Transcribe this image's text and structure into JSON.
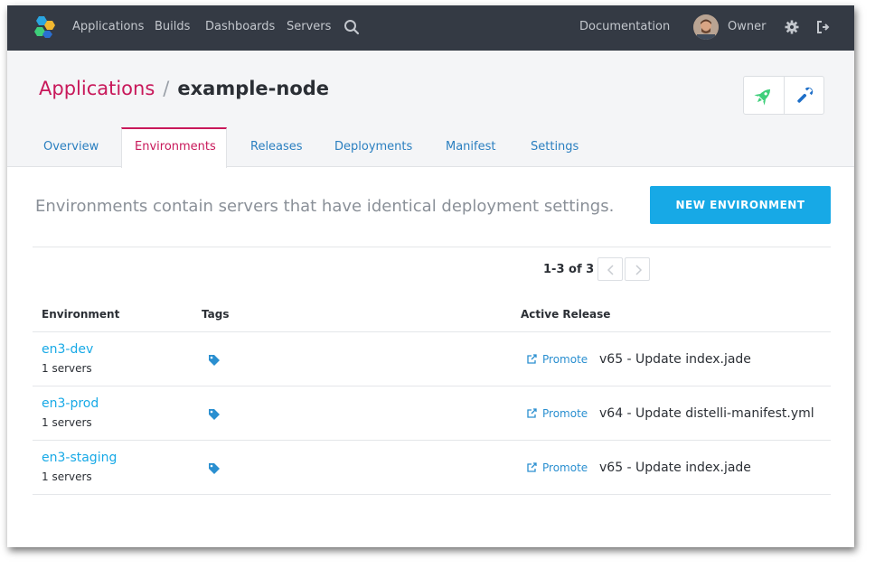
{
  "nav": {
    "items": [
      "Applications",
      "Builds",
      "Dashboards",
      "Servers"
    ],
    "documentation": "Documentation",
    "user": "Owner"
  },
  "breadcrumb": {
    "parent": "Applications",
    "separator": "/",
    "current": "example-node"
  },
  "tabs": [
    {
      "label": "Overview",
      "active": false
    },
    {
      "label": "Environments",
      "active": true
    },
    {
      "label": "Releases",
      "active": false
    },
    {
      "label": "Deployments",
      "active": false
    },
    {
      "label": "Manifest",
      "active": false
    },
    {
      "label": "Settings",
      "active": false
    }
  ],
  "content": {
    "description": "Environments contain servers that have identical deployment settings.",
    "new_button": "NEW ENVIRONMENT",
    "pagination": "1-3 of 3"
  },
  "table": {
    "headers": {
      "environment": "Environment",
      "tags": "Tags",
      "active_release": "Active Release"
    },
    "rows": [
      {
        "name": "en3-dev",
        "servers": "1 servers",
        "promote": "Promote",
        "release": "v65 - Update index.jade"
      },
      {
        "name": "en3-prod",
        "servers": "1 servers",
        "promote": "Promote",
        "release": "v64 - Update distelli-manifest.yml"
      },
      {
        "name": "en3-staging",
        "servers": "1 servers",
        "promote": "Promote",
        "release": "v65 - Update index.jade"
      }
    ]
  },
  "icons": {
    "logo": "hexagon-logo-icon",
    "search": "search-icon",
    "settings": "gear-icon",
    "signout": "sign-out-icon",
    "rocket": "rocket-icon",
    "wrench": "wrench-icon",
    "tag": "tag-icon",
    "promote": "share-icon",
    "prev": "chevron-left-icon",
    "next": "chevron-right-icon"
  },
  "colors": {
    "nav_bg": "#343a44",
    "accent_pink": "#c8185a",
    "link_blue": "#17a9e6",
    "tab_blue": "#2a7fc0",
    "rocket_green": "#3ecf7a",
    "wrench_blue": "#1e6fc8"
  }
}
